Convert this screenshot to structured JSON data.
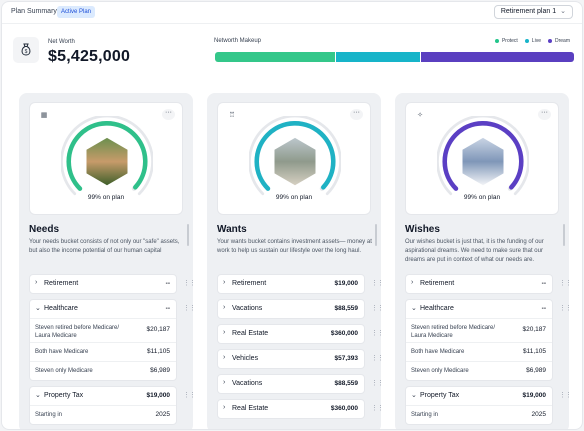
{
  "header": {
    "title": "Plan Summary",
    "badge": "Active Plan",
    "plan_select": "Retirement plan 1"
  },
  "networth": {
    "label": "Net Worth",
    "value": "$5,425,000"
  },
  "makeup": {
    "label": "Networth Makeup",
    "legend": [
      {
        "name": "Protect",
        "color": "#22c58b"
      },
      {
        "name": "Live",
        "color": "#17b4c9"
      },
      {
        "name": "Dream",
        "color": "#5b3fc4"
      }
    ],
    "segments": [
      {
        "name": "Protect",
        "fraction": 0.335,
        "color": "#34c78a"
      },
      {
        "name": "Live",
        "fraction": 0.235,
        "color": "#17b4c9"
      },
      {
        "name": "Dream",
        "fraction": 0.43,
        "color": "#5a3fc0"
      }
    ]
  },
  "columns": [
    {
      "title": "Needs",
      "icon": "grid-icon",
      "on_plan": "99% on plan",
      "progress": 0.99,
      "color": "#2fc08a",
      "description": "Your needs bucket consists of not only our \"safe\" assets, but also the income potential of our human capital",
      "items": [
        {
          "name": "Retirement",
          "amount": "--",
          "expanded": false,
          "rows": []
        },
        {
          "name": "Healthcare",
          "amount": "--",
          "expanded": true,
          "rows": [
            {
              "label": "Steven retired before Medicare/ Laura Medicare",
              "value": "$20,187"
            },
            {
              "label": "Both have Medicare",
              "value": "$11,105"
            },
            {
              "label": "Steven only Medicare",
              "value": "$6,989"
            }
          ]
        },
        {
          "name": "Property Tax",
          "amount": "$19,000",
          "expanded": true,
          "rows": [
            {
              "label": "Starting in",
              "value": "2025"
            }
          ]
        }
      ]
    },
    {
      "title": "Wants",
      "icon": "people-icon",
      "on_plan": "99% on plan",
      "progress": 0.99,
      "color": "#1fb2c4",
      "description": "Your wants bucket contains investment assets— money at work to help us sustain our lifestyle over the long haul.",
      "items": [
        {
          "name": "Retirement",
          "amount": "$19,000",
          "expanded": false,
          "rows": []
        },
        {
          "name": "Vacations",
          "amount": "$88,559",
          "expanded": false,
          "rows": []
        },
        {
          "name": "Real Estate",
          "amount": "$360,000",
          "expanded": false,
          "rows": []
        },
        {
          "name": "Vehicles",
          "amount": "$57,393",
          "expanded": false,
          "rows": []
        },
        {
          "name": "Vacations",
          "amount": "$88,559",
          "expanded": false,
          "rows": []
        },
        {
          "name": "Real Estate",
          "amount": "$360,000",
          "expanded": false,
          "rows": []
        }
      ]
    },
    {
      "title": "Wishes",
      "icon": "sparkle-icon",
      "on_plan": "99% on plan",
      "progress": 0.99,
      "color": "#5b3fc4",
      "description": "Our wishes bucket is just that, it is the funding of our aspirational dreams.  We need to make sure that our dreams are put in context of what our needs are.",
      "items": [
        {
          "name": "Retirement",
          "amount": "--",
          "expanded": false,
          "rows": []
        },
        {
          "name": "Healthcare",
          "amount": "--",
          "expanded": true,
          "rows": [
            {
              "label": "Steven retired before Medicare/ Laura Medicare",
              "value": "$20,187"
            },
            {
              "label": "Both have Medicare",
              "value": "$11,105"
            },
            {
              "label": "Steven only Medicare",
              "value": "$6,989"
            }
          ]
        },
        {
          "name": "Property Tax",
          "amount": "$19,000",
          "expanded": true,
          "rows": [
            {
              "label": "Starting in",
              "value": "2025"
            }
          ]
        }
      ]
    }
  ]
}
